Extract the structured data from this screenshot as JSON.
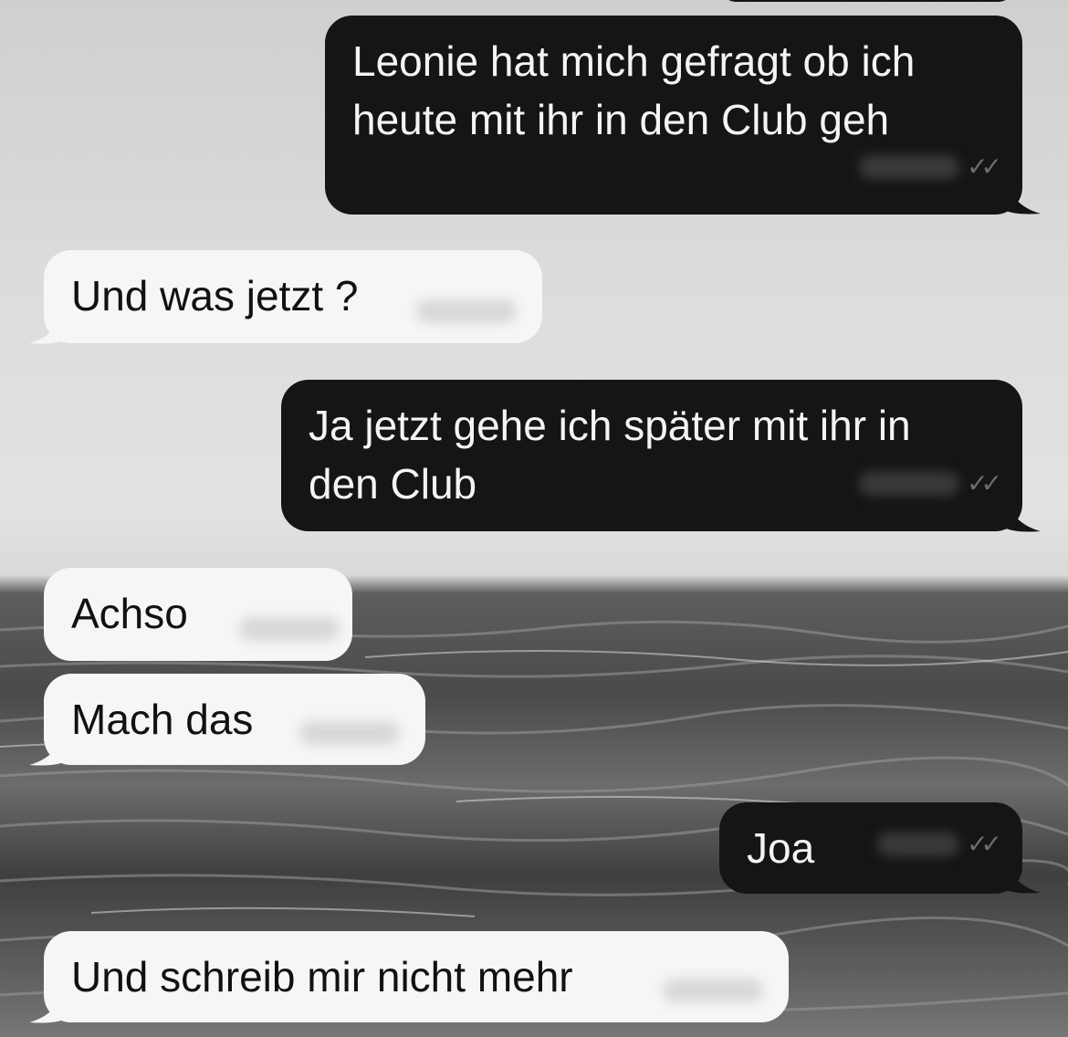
{
  "messages": [
    {
      "direction": "out",
      "text_lines": [
        "Leonie hat mich gefragt ob ich",
        "heute mit ihr in den Club geh"
      ],
      "status_icon": "double-check-icon"
    },
    {
      "direction": "in",
      "text": "Und was jetzt ?"
    },
    {
      "direction": "out",
      "text_lines": [
        "Ja jetzt gehe ich später mit ihr in",
        "den Club"
      ],
      "status_icon": "double-check-icon"
    },
    {
      "direction": "in",
      "text": "Achso"
    },
    {
      "direction": "in",
      "text": "Mach das"
    },
    {
      "direction": "out",
      "text": "Joa",
      "status_icon": "double-check-icon"
    },
    {
      "direction": "in",
      "text": "Und schreib mir nicht mehr"
    }
  ],
  "colors": {
    "incoming_bubble": "#f6f6f6",
    "outgoing_bubble": "#151515",
    "incoming_text": "#111111",
    "outgoing_text": "#f4f4f4"
  },
  "wallpaper": "black-and-white sea"
}
